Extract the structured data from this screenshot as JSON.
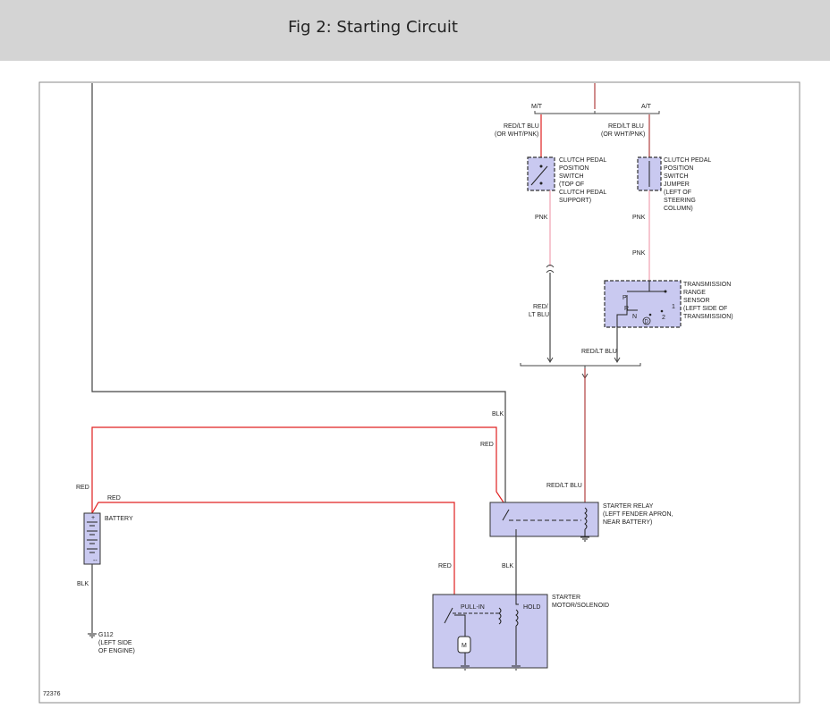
{
  "header": {
    "title": "Fig 2: Starting Circuit"
  },
  "colors": {
    "header_bg": "#d4d4d4",
    "component_fill": "#c9c9f0",
    "wire_red": "#e02020",
    "wire_pink": "#f0a0b0",
    "wire_black": "#444444",
    "wire_red_lt_blu": "#b04040"
  },
  "diagram": {
    "figure_number": "72376",
    "branch_mt": "M/T",
    "branch_at": "A/T",
    "wire_mt_top_1": "RED/LT BLU",
    "wire_mt_top_2": "(OR WHT/PNK)",
    "wire_at_top_1": "RED/LT BLU",
    "wire_at_top_2": "(OR WHT/PNK)",
    "clutch_switch_label": [
      "CLUTCH PEDAL",
      "POSITION",
      "SWITCH",
      "(TOP OF",
      "CLUTCH PEDAL",
      "SUPPORT)"
    ],
    "clutch_jumper_label": [
      "CLUTCH PEDAL",
      "POSITION",
      "SWITCH",
      "JUMPER",
      "(LEFT OF",
      "STEERING",
      "COLUMN)"
    ],
    "wire_pnk_1": "PNK",
    "wire_pnk_2": "PNK",
    "wire_pnk_3": "PNK",
    "trs_label": [
      "TRANSMISSION",
      "RANGE",
      "SENSOR",
      "(LEFT SIDE OF",
      "TRANSMISSION)"
    ],
    "trs_positions": {
      "p": "P",
      "r": "R",
      "n": "N",
      "d": "D",
      "one": "1",
      "two": "2"
    },
    "wire_red_lt_blu_left_1": "RED/",
    "wire_red_lt_blu_left_2": "LT BLU",
    "wire_red_lt_blu_right": "RED/LT BLU",
    "wire_red_lt_blu_relay": "RED/LT BLU",
    "wire_blk_relay_in": "BLK",
    "wire_red_relay_in": "RED",
    "wire_red_battery": "RED",
    "wire_red_battery_2": "RED",
    "starter_relay_label": [
      "STARTER RELAY",
      "(LEFT FENDER APRON,",
      "NEAR BATTERY)"
    ],
    "battery_label": "BATTERY",
    "battery_plus": "+",
    "battery_minus": "--",
    "wire_blk_battery": "BLK",
    "ground_label": [
      "G112",
      "(LEFT SIDE",
      "OF ENGINE)"
    ],
    "wire_red_solenoid": "RED",
    "wire_blk_solenoid": "BLK",
    "starter_motor_label": [
      "STARTER",
      "MOTOR/SOLENOID"
    ],
    "pull_in_label": "PULL-IN",
    "hold_label": "HOLD",
    "motor_symbol": "M"
  }
}
